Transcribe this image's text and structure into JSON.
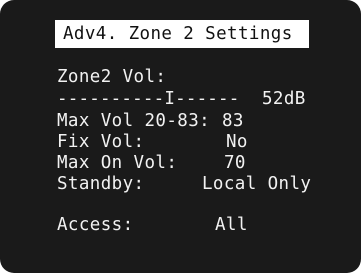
{
  "screen": {
    "title": "Adv4. Zone 2 Settings",
    "zone2_vol_label": "Zone2 Vol:",
    "volume_bar": "----------I------",
    "volume_value": "52dB",
    "max_vol_label": "Max Vol 20-83:",
    "max_vol_value": "83",
    "fix_vol_label": "Fix Vol:",
    "fix_vol_value": "No",
    "max_on_vol_label": "Max On Vol:",
    "max_on_vol_value": "70",
    "standby_label": "Standby:",
    "standby_value": "Local Only",
    "access_label": "Access:",
    "access_value": "All"
  }
}
